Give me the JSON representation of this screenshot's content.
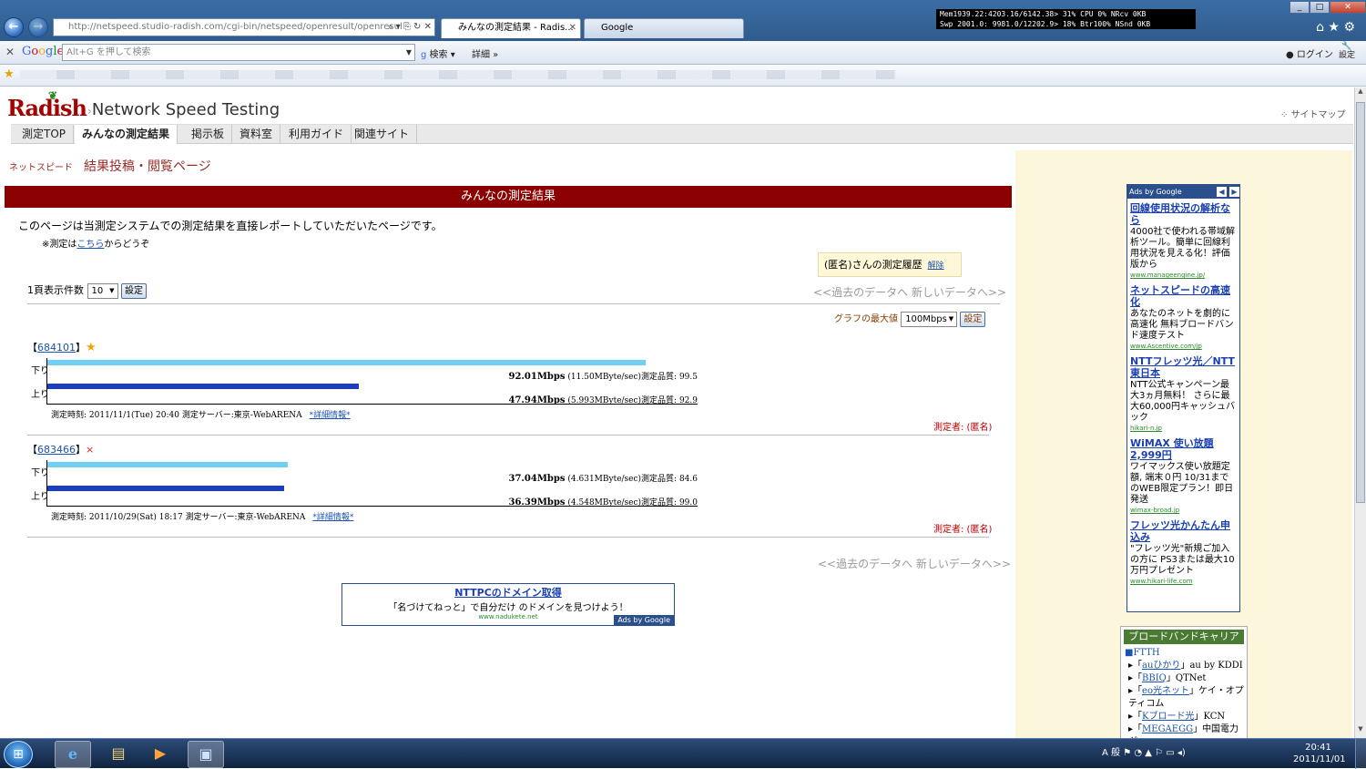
{
  "browser": {
    "address_url": "http://netspeed.studio-radish.com/cgi-bin/netspeed/openresult/openresul",
    "tabs": [
      {
        "label": "みんなの測定結果 - Radis...",
        "active": true
      },
      {
        "label": "Google",
        "active": false
      }
    ],
    "perf_line1": "Mem1939.22:4203.16/6142.38> 31% CPU  0% NRcv  0KB",
    "perf_line2": "Swp 2001.0: 9981.0/12202.9> 18% Btr100% NSnd  0KB",
    "google_toolbar": {
      "logo": "Google",
      "search_placeholder": "Alt+G を押して検索",
      "search_label": "検索",
      "details_label": "詳細",
      "login_label": "ログイン",
      "settings_label": "設定"
    }
  },
  "site": {
    "logo": "Radish",
    "title": "Network Speed Testing",
    "sitemap": "サイトマップ",
    "menu": [
      "測定TOP",
      "みんなの測定結果",
      "掲示板",
      "資料室",
      "利用ガイド",
      "関連サイト"
    ],
    "breadcrumb_small": "ネットスピード",
    "breadcrumb_big": "結果投稿・閲覧ページ",
    "section_title": "みんなの測定結果",
    "intro": "このページは当測定システムでの測定結果を直接レポートしていただいたページです。",
    "note_prefix": "※測定は",
    "note_link": "こちら",
    "note_suffix": "からどうぞ",
    "history_label": "(匿名)さんの測定履歴",
    "history_release": "解除",
    "per_page_label": "1頁表示件数",
    "per_page_value": "10",
    "set_button": "設定",
    "pager": "<<過去のデータへ 新しいデータへ>>",
    "graph_max_label": "グラフの最大値",
    "graph_max_value": "100Mbps",
    "max_mbps": 100
  },
  "results": [
    {
      "id": "684101",
      "mark": "★",
      "down_label": "下り",
      "up_label": "上り",
      "down_mbps": 92.01,
      "up_mbps": 47.94,
      "down_text": "92.01Mbps",
      "down_detail": "(11.50MByte/sec)測定品質: 99.5",
      "up_text": "47.94Mbps",
      "up_detail": "(5.993MByte/sec)測定品質: 92.9",
      "meta": "測定時刻: 2011/11/1(Tue) 20:40 測定サーバー:東京-WebARENA",
      "detail_link": "*詳細情報*",
      "measurer": "測定者: (匿名)"
    },
    {
      "id": "683466",
      "mark": "×",
      "down_label": "下り",
      "up_label": "上り",
      "down_mbps": 37.04,
      "up_mbps": 36.39,
      "down_text": "37.04Mbps",
      "down_detail": "(4.631MByte/sec)測定品質: 84.6",
      "up_text": "36.39Mbps",
      "up_detail": "(4.548MByte/sec)測定品質: 99.0",
      "meta": "測定時刻: 2011/10/29(Sat) 18:17 測定サーバー:東京-WebARENA",
      "detail_link": "*詳細情報*",
      "measurer": "測定者: (匿名)"
    }
  ],
  "bottom_ad": {
    "title": "NTTPCのドメイン取得",
    "body": "「名づけてねっと」で自分だけ のドメインを見つけよう！",
    "url": "www.nadukete.net",
    "adsby": "Ads by Google"
  },
  "side_ads": {
    "header": "Ads by Google",
    "items": [
      {
        "title": "回線使用状況の解析なら",
        "body": "4000社で使われる帯域解析ツール。簡単に回線利用状況を見える化！評価版から",
        "url": "www.manageengine.jp/"
      },
      {
        "title": "ネットスピードの高速化",
        "body": "あなたのネットを劇的に高速化 無料ブロードバンド速度テスト",
        "url": "www.Ascentive.com/jp"
      },
      {
        "title": "NTTフレッツ光／NTT東日本",
        "body": "NTT公式キャンペーン最大3ヵ月無料！ さらに最大60,000円キャッシュバック",
        "url": "hikari-n.jp"
      },
      {
        "title": "WiMAX 使い放題 2,999円",
        "body": "ワイマックス使い放題定額, 端末０円 10/31までのWEB限定プラン！即日発送",
        "url": "wimax-broad.jp"
      },
      {
        "title": "フレッツ光かんたん申込み",
        "body": "\"フレッツ光\"新規ご加入の方に PS3または最大10万円プレゼント",
        "url": "www.hikari-life.com"
      }
    ]
  },
  "broadband": {
    "header": "ブロードバンドキャリア",
    "category": "■FTTH",
    "items": [
      {
        "link": "auひかり",
        "suffix": "au by KDDI"
      },
      {
        "link": "BBIQ",
        "suffix": "QTNet"
      },
      {
        "link": "eo光ネット",
        "suffix": "ケイ・オプティコム"
      },
      {
        "link": "Kブロード光",
        "suffix": "KCN"
      },
      {
        "link": "MEGAEGG",
        "suffix": "中国電力グ"
      }
    ]
  },
  "taskbar": {
    "clock_time": "20:41",
    "clock_date": "2011/11/01",
    "ime": "A 般"
  }
}
